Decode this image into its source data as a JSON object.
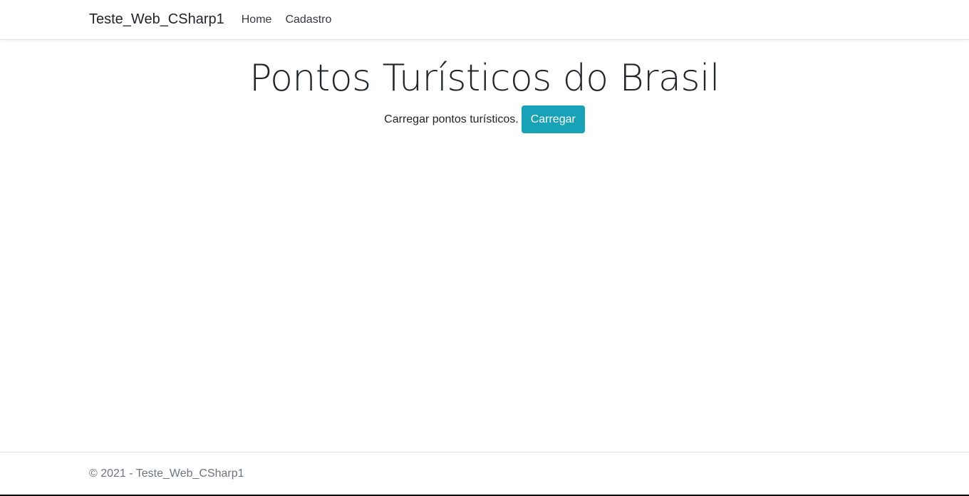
{
  "navbar": {
    "brand": "Teste_Web_CSharp1",
    "links": [
      {
        "label": "Home"
      },
      {
        "label": "Cadastro"
      }
    ]
  },
  "main": {
    "title": "Pontos Turísticos do Brasil",
    "load_text": "Carregar pontos turísticos.",
    "load_button_label": "Carregar"
  },
  "footer": {
    "text": "© 2021 - Teste_Web_CSharp1"
  },
  "colors": {
    "accent": "#17a2b8",
    "text": "#212529",
    "muted": "#6c757d",
    "border": "#dee2e6"
  }
}
